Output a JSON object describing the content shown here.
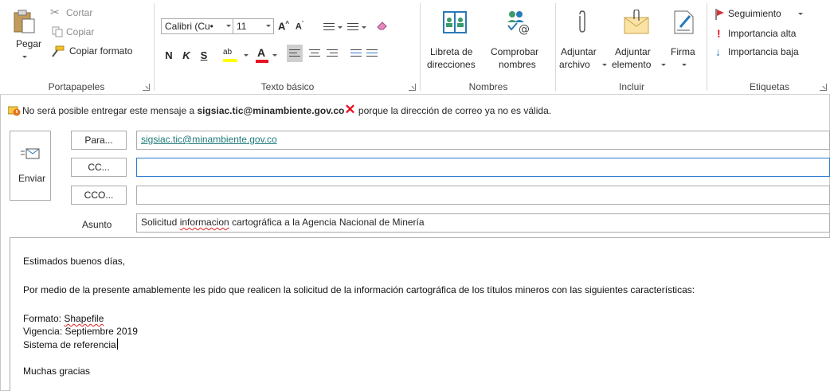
{
  "ribbon": {
    "portapapeles": {
      "group_label": "Portapapeles",
      "paste_label": "Pegar",
      "cut_label": "Cortar",
      "copy_label": "Copiar",
      "format_label": "Copiar formato"
    },
    "texto_basico": {
      "group_label": "Texto básico",
      "font_name": "Calibri (Cu•",
      "font_size": "11",
      "bold": "N",
      "italic": "K",
      "underline": "S"
    },
    "nombres": {
      "group_label": "Nombres",
      "libreta_line1": "Libreta de",
      "libreta_line2": "direcciones",
      "comprobar_line1": "Comprobar",
      "comprobar_line2": "nombres"
    },
    "incluir": {
      "group_label": "Incluir",
      "adjuntar_archivo_line1": "Adjuntar",
      "adjuntar_archivo_line2": "archivo",
      "adjuntar_elemento_line1": "Adjuntar",
      "adjuntar_elemento_line2": "elemento",
      "firma_label": "Firma"
    },
    "etiquetas": {
      "group_label": "Etiquetas",
      "seguimiento": "Seguimiento",
      "importancia_alta": "Importancia alta",
      "importancia_baja": "Importancia baja"
    }
  },
  "infobar": {
    "prefix": "No será posible entregar este mensaje a ",
    "address": "sigsiac.tic@minambiente.gov.co",
    "suffix": " porque la dirección de correo ya no es válida."
  },
  "compose": {
    "send_label": "Enviar",
    "to_label": "Para...",
    "cc_label": "CC...",
    "bcc_label": "CCO...",
    "subject_label": "Asunto",
    "to_value": "sigsiac.tic@minambiente.gov.co",
    "cc_value": "",
    "bcc_value": "",
    "subject_before": "Solicitud ",
    "subject_misspelled": "informacion",
    "subject_after": " cartográfica a la Agencia Nacional de Minería"
  },
  "body": {
    "greeting": "Estimados buenos días,",
    "paragraph": "Por medio de la presente amablemente les pido que realicen la solicitud de la información cartográfica de los títulos mineros con las siguientes características:",
    "formato_label": "Formato: ",
    "formato_value": "Shapefile",
    "vigencia": "Vigencia: Septiembre 2019",
    "sistema": "Sistema de referencia",
    "closing": "Muchas gracias"
  },
  "colors": {
    "recipient_link": "#1f7a7a",
    "error_red": "#e81123",
    "flag_red": "#d13438",
    "focus_border": "#2b79d0"
  }
}
